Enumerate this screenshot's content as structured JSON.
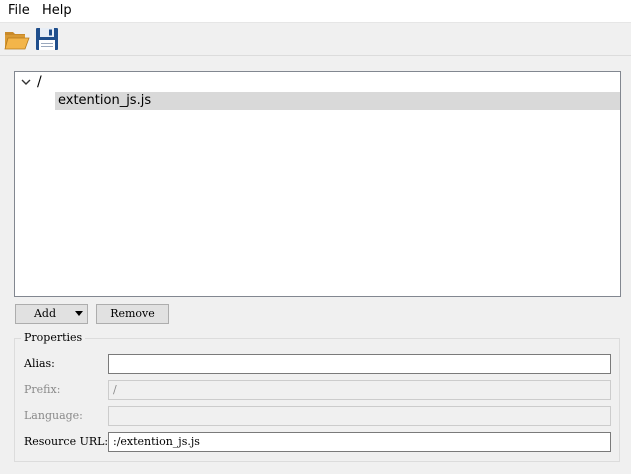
{
  "menubar": {
    "items": [
      {
        "label": "File"
      },
      {
        "label": "Help"
      }
    ]
  },
  "toolbar": {
    "buttons": [
      {
        "icon": "open-folder-icon"
      },
      {
        "icon": "save-icon"
      }
    ]
  },
  "tree": {
    "root": {
      "label": "/",
      "expanded": true
    },
    "children": [
      {
        "label": "extention_js.js",
        "selected": true
      }
    ]
  },
  "actions": {
    "add_label": "Add",
    "remove_label": "Remove"
  },
  "properties": {
    "title": "Properties",
    "alias": {
      "label": "Alias:",
      "value": ""
    },
    "prefix": {
      "label": "Prefix:",
      "value": "/",
      "enabled": false
    },
    "language": {
      "label": "Language:",
      "value": "",
      "enabled": false
    },
    "resource_url": {
      "label": "Resource URL:",
      "value": ":/extention_js.js"
    }
  },
  "colors": {
    "window_bg": "#f0f0f0",
    "selection_bg": "#d9d9d9",
    "folder_orange": "#e8a33a",
    "floppy_blue": "#1f4e8c"
  }
}
